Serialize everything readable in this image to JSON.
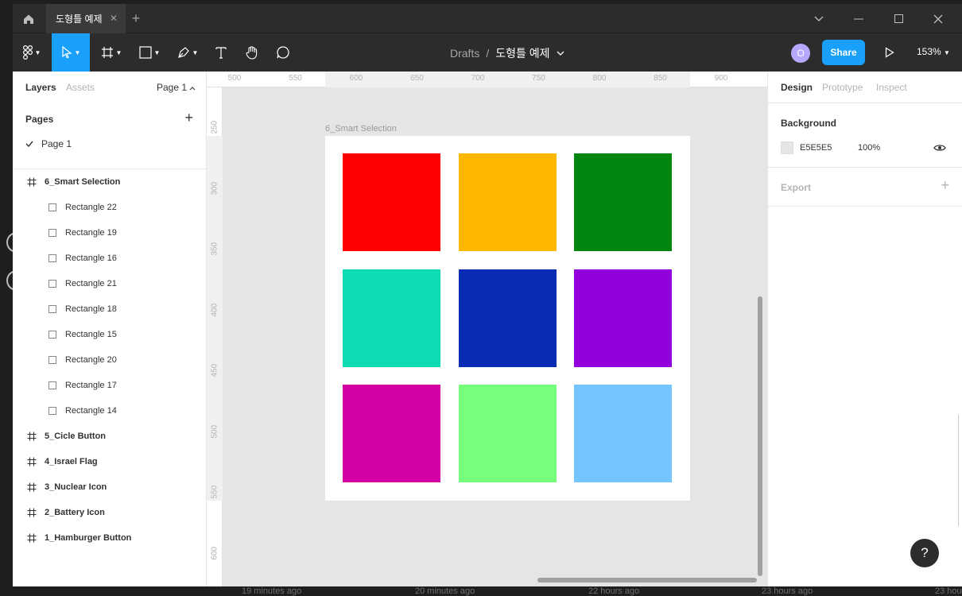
{
  "desktop": {
    "timestamps": [
      "19 minutes ago",
      "20 minutes ago",
      "22 hours ago",
      "23 hours ago",
      "23 hou"
    ]
  },
  "titlebar": {
    "tab_title": "도형틀 예제",
    "close_glyph": "✕",
    "add_glyph": "+"
  },
  "toolbar": {
    "breadcrumb_folder": "Drafts",
    "breadcrumb_sep": "/",
    "file_name": "도형틀 예제",
    "avatar_letter": "O",
    "avatar_color": "#b7a7ff",
    "share_label": "Share",
    "zoom_label": "153%",
    "accent": "#18a0fb"
  },
  "left_panel": {
    "tabs": [
      "Layers",
      "Assets"
    ],
    "page_selector": "Page 1",
    "pages_title": "Pages",
    "pages": [
      {
        "label": "Page 1",
        "selected": true
      }
    ],
    "layers": [
      {
        "label": "6_Smart Selection",
        "type": "frame"
      },
      {
        "label": "Rectangle 22",
        "type": "rect"
      },
      {
        "label": "Rectangle 19",
        "type": "rect"
      },
      {
        "label": "Rectangle 16",
        "type": "rect"
      },
      {
        "label": "Rectangle 21",
        "type": "rect"
      },
      {
        "label": "Rectangle 18",
        "type": "rect"
      },
      {
        "label": "Rectangle 15",
        "type": "rect"
      },
      {
        "label": "Rectangle 20",
        "type": "rect"
      },
      {
        "label": "Rectangle 17",
        "type": "rect"
      },
      {
        "label": "Rectangle 14",
        "type": "rect"
      },
      {
        "label": "5_Cicle Button",
        "type": "frame"
      },
      {
        "label": "4_Israel Flag",
        "type": "frame"
      },
      {
        "label": "3_Nuclear Icon",
        "type": "frame"
      },
      {
        "label": "2_Battery Icon",
        "type": "frame"
      },
      {
        "label": "1_Hamburger Button",
        "type": "frame"
      }
    ]
  },
  "canvas": {
    "background": "#e5e5e5",
    "ruler_top": [
      "500",
      "550",
      "600",
      "650",
      "700",
      "750",
      "800",
      "850",
      "900"
    ],
    "ruler_left": [
      "250",
      "300",
      "350",
      "400",
      "450",
      "500",
      "550",
      "600"
    ],
    "frame_label": "6_Smart Selection",
    "squares": [
      "#ff0000",
      "#ffb800",
      "#00850f",
      "#0ddbb4",
      "#0a2bb4",
      "#9300dc",
      "#d300a3",
      "#75ff7b",
      "#74c5ff"
    ]
  },
  "right_panel": {
    "tabs": [
      "Design",
      "Prototype",
      "Inspect"
    ],
    "background_title": "Background",
    "background_hex": "E5E5E5",
    "background_opacity": "100%",
    "export_title": "Export"
  },
  "help_label": "?"
}
